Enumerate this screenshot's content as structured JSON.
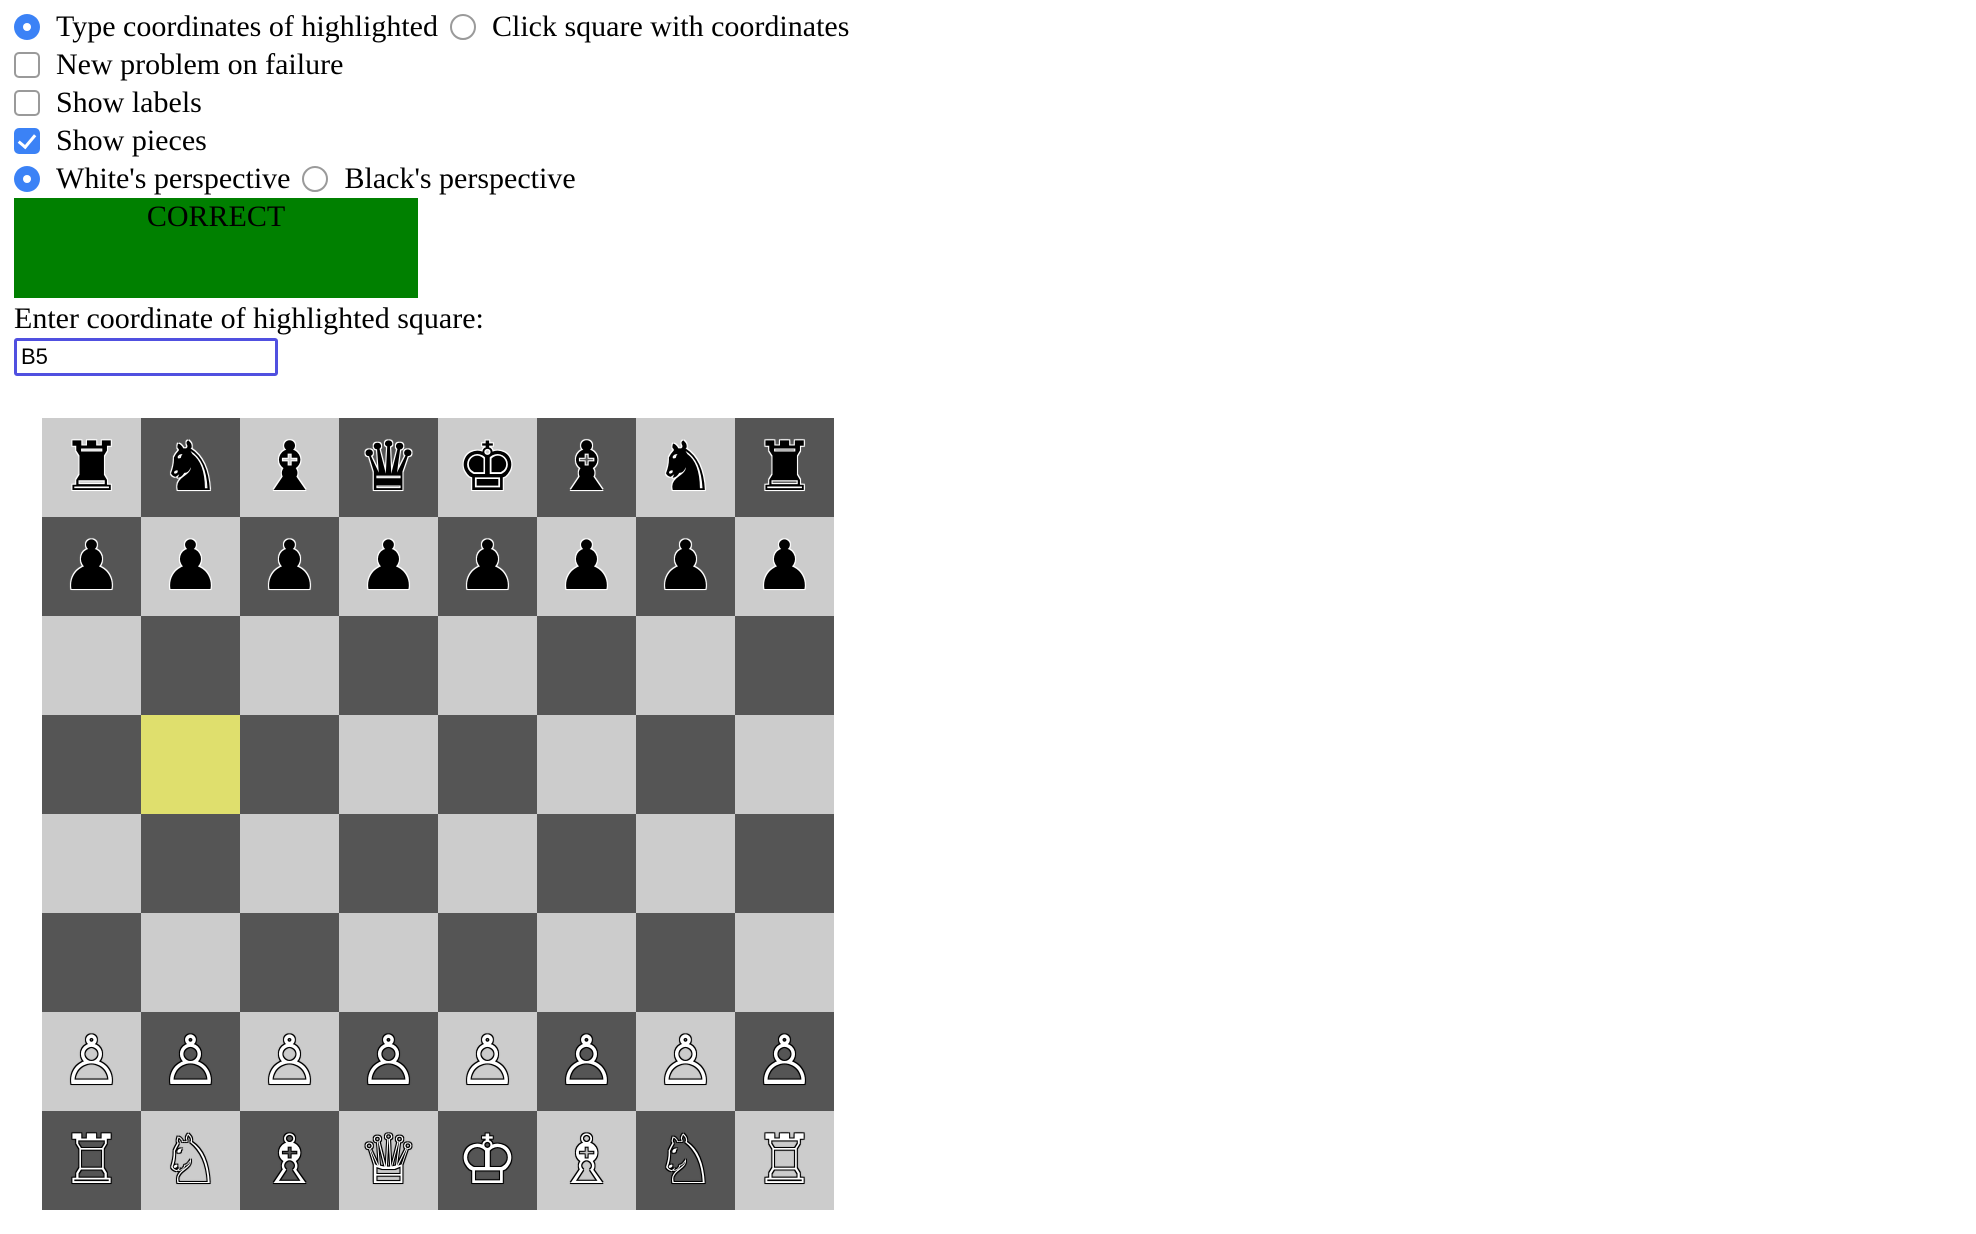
{
  "options": {
    "mode": {
      "type_label": "Type coordinates of highlighted",
      "click_label": "Click square with coordinates",
      "selected": "type"
    },
    "new_problem_on_failure": {
      "label": "New problem on failure",
      "checked": false
    },
    "show_labels": {
      "label": "Show labels",
      "checked": false
    },
    "show_pieces": {
      "label": "Show pieces",
      "checked": true
    },
    "perspective": {
      "white_label": "White's perspective",
      "black_label": "Black's perspective",
      "selected": "white"
    }
  },
  "status": {
    "text": "CORRECT",
    "color": "#008000"
  },
  "prompt": {
    "label": "Enter coordinate of highlighted square:",
    "value": "B5"
  },
  "board": {
    "highlighted_square": "b5",
    "colors": {
      "light": "#cccccc",
      "dark": "#555555",
      "highlight": "#dfdf6d"
    },
    "rows": [
      [
        "♜",
        "♞",
        "♝",
        "♛",
        "♚",
        "♝",
        "♞",
        "♜"
      ],
      [
        "♟",
        "♟",
        "♟",
        "♟",
        "♟",
        "♟",
        "♟",
        "♟"
      ],
      [
        "",
        "",
        "",
        "",
        "",
        "",
        "",
        ""
      ],
      [
        "",
        "",
        "",
        "",
        "",
        "",
        "",
        ""
      ],
      [
        "",
        "",
        "",
        "",
        "",
        "",
        "",
        ""
      ],
      [
        "",
        "",
        "",
        "",
        "",
        "",
        "",
        ""
      ],
      [
        "♙",
        "♙",
        "♙",
        "♙",
        "♙",
        "♙",
        "♙",
        "♙"
      ],
      [
        "♖",
        "♘",
        "♗",
        "♕",
        "♔",
        "♗",
        "♘",
        "♖"
      ]
    ]
  }
}
